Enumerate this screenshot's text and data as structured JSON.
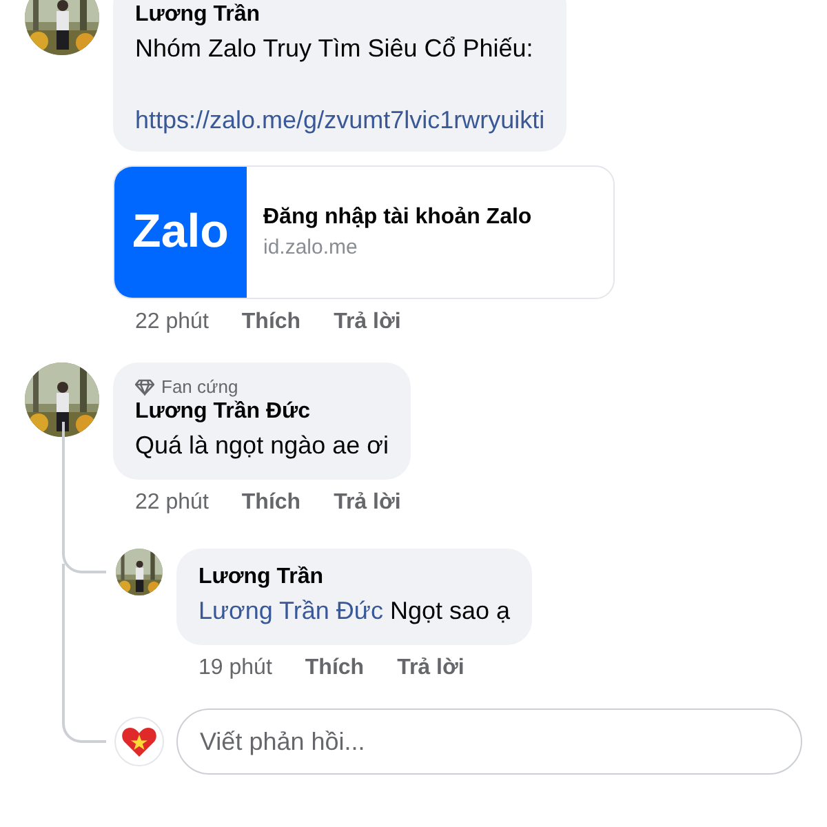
{
  "comments": [
    {
      "author": "Lương Trần",
      "text": "Nhóm Zalo Truy Tìm Siêu Cổ Phiếu:",
      "link": "https://zalo.me/g/zvumt7lvic1rwryuikti",
      "preview": {
        "logo": "Zalo",
        "title": "Đăng nhập tài khoản Zalo",
        "domain": "id.zalo.me"
      },
      "time": "22 phút",
      "actions": [
        "Thích",
        "Trả lời"
      ]
    },
    {
      "badge": "Fan cứng",
      "author": "Lương Trần Đức",
      "text": "Quá là ngọt ngào ae ơi",
      "time": "22 phút",
      "actions": [
        "Thích",
        "Trả lời"
      ],
      "replies": [
        {
          "author": "Lương Trần",
          "mention": "Lương Trần Đức",
          "text": "Ngọt sao ạ",
          "time": "19 phút",
          "actions": [
            "Thích",
            "Trả lời"
          ]
        }
      ],
      "reply_field": {
        "placeholder": "Viết phản hồi..."
      }
    }
  ]
}
